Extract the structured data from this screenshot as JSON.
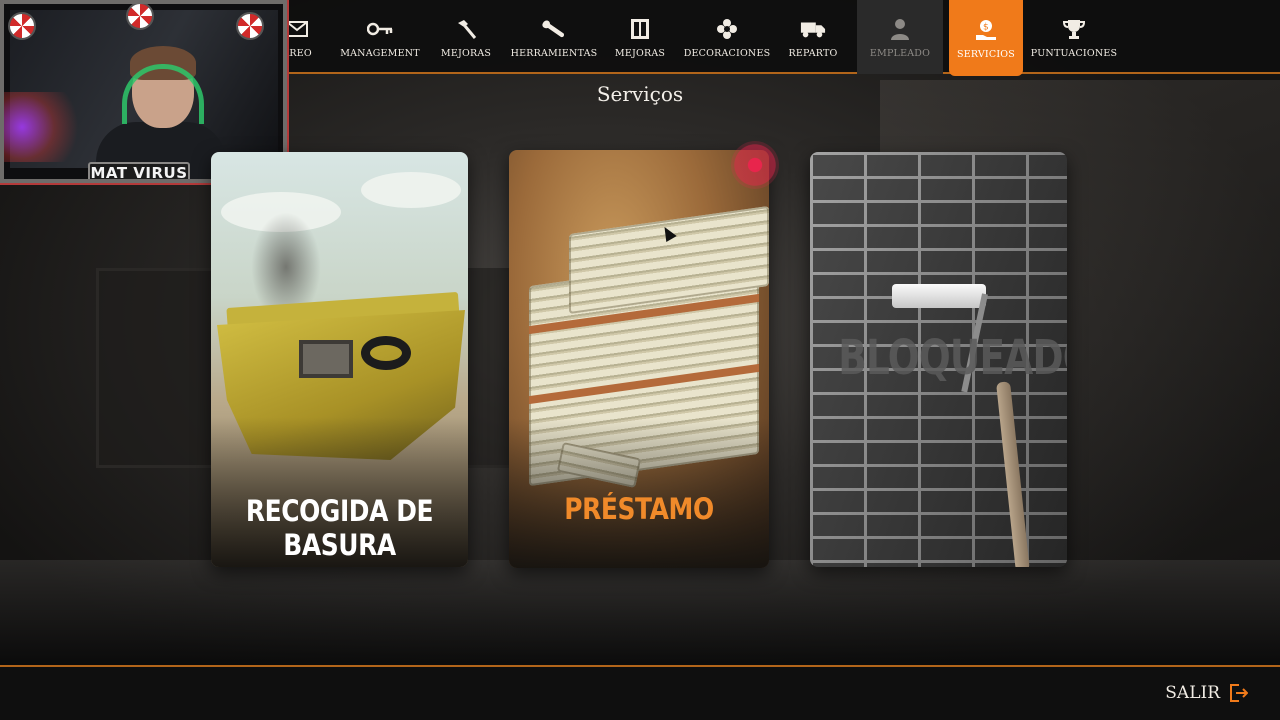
{
  "webcam": {
    "streamer_name": "MAT VIRUS"
  },
  "nav": {
    "items": [
      {
        "label": "RREO",
        "icon": "envelope-icon",
        "state": "normal"
      },
      {
        "label": "MANAGEMENT",
        "icon": "key-icon",
        "state": "normal"
      },
      {
        "label": "MEJORAS",
        "icon": "hammer-icon",
        "state": "normal"
      },
      {
        "label": "HERRAMIENTAS",
        "icon": "wrench-icon",
        "state": "normal"
      },
      {
        "label": "MEJORAS",
        "icon": "cabinet-icon",
        "state": "normal"
      },
      {
        "label": "DECORACIONES",
        "icon": "flower-icon",
        "state": "normal"
      },
      {
        "label": "REPARTO",
        "icon": "truck-icon",
        "state": "normal"
      },
      {
        "label": "EMPLEADO",
        "icon": "person-icon",
        "state": "disabled"
      },
      {
        "label": "SERVICIOS",
        "icon": "money-hand-icon",
        "state": "active"
      },
      {
        "label": "PUNTUACIONES",
        "icon": "trophy-icon",
        "state": "normal"
      }
    ]
  },
  "page": {
    "title": "Serviços"
  },
  "cards": {
    "basura": {
      "label": "RECOGIDA DE BASURA",
      "color": "#ffffff"
    },
    "prestamo": {
      "label": "PRÉSTAMO",
      "color": "#f08a2a"
    },
    "bloqueado": {
      "label": "BLOQUEADO"
    }
  },
  "footer": {
    "exit_label": "SALIR",
    "exit_icon": "exit-icon"
  },
  "colors": {
    "accent": "#f07a1a",
    "divider": "#b2651a"
  }
}
